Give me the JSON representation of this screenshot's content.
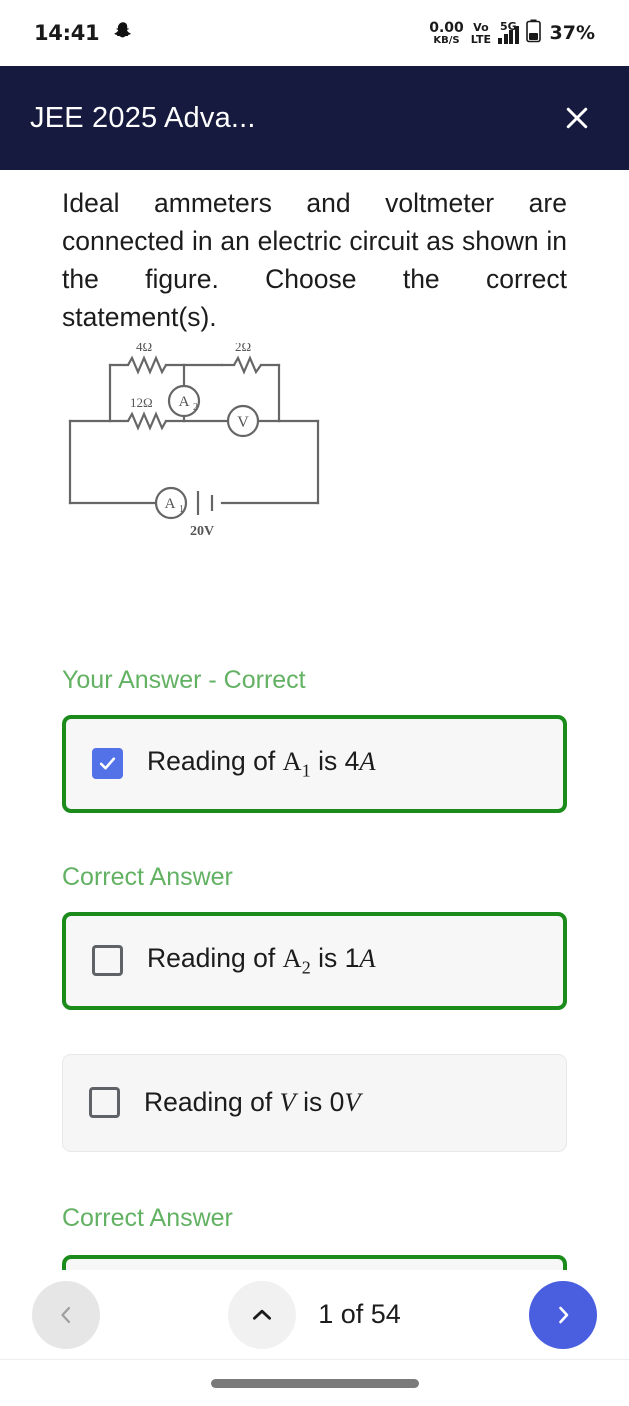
{
  "statusbar": {
    "time": "14:41",
    "snap_icon": "snapchat-icon",
    "net_speed_value": "0.00",
    "net_speed_unit": "KB/S",
    "volte_top": "Vo",
    "volte_bottom": "LTE",
    "network_type": "5G",
    "signal_icon": "signal-bars-icon",
    "battery_icon": "battery-icon",
    "battery_percent": "37%"
  },
  "header": {
    "title": "JEE 2025 Adva...",
    "close_label": "close-icon"
  },
  "question": {
    "text": "Ideal ammeters and voltmeter are connected in an electric circuit as shown in the figure. Choose the correct statement(s)."
  },
  "figure": {
    "name": "circuit-diagram",
    "r_top_left": "4Ω",
    "r_top_right": "2Ω",
    "r_middle_left": "12Ω",
    "ammeter_2": "A",
    "ammeter_2_sub": "2",
    "voltmeter": "V",
    "ammeter_1": "A",
    "ammeter_1_sub": "1",
    "battery": "20V"
  },
  "sections": {
    "your_answer": "Your Answer - Correct",
    "correct_answer_1": "Correct Answer",
    "correct_answer_2": "Correct Answer"
  },
  "options": [
    {
      "prefix": "Reading of ",
      "symbol": "A",
      "symbol_sub": "1",
      "middle": " is ",
      "value": "4",
      "unit": "A",
      "checked": true,
      "correct": true
    },
    {
      "prefix": "Reading of ",
      "symbol": "A",
      "symbol_sub": "2",
      "middle": " is ",
      "value": "1",
      "unit": "A",
      "checked": false,
      "correct": true
    },
    {
      "prefix": "Reading of ",
      "symbol": "V",
      "symbol_sub": "",
      "middle": " is ",
      "value": "0",
      "unit": "V",
      "checked": false,
      "correct": false
    }
  ],
  "bottomnav": {
    "prev_icon": "chevron-left-icon",
    "collapse_icon": "chevron-up-icon",
    "page_count": "1 of 54",
    "next_icon": "chevron-right-icon"
  },
  "colors": {
    "header_bg": "#151a3e",
    "correct_border": "#1b8b1b",
    "section_green": "#63b163",
    "checkbox_blue": "#5472e8",
    "next_blue": "#4a5fe0"
  }
}
